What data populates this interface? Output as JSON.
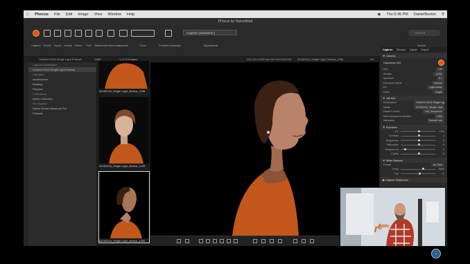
{
  "menubar": {
    "app": "Phocus",
    "items": [
      "File",
      "Edit",
      "Image",
      "View",
      "Window",
      "Help"
    ],
    "clock": "Thu 5:36 PM",
    "user": "DanielNorton"
  },
  "window_title": "Phocus by Hasselblad",
  "toolbar": {
    "items": [
      "Capture",
      "Export",
      "Import",
      "Modify",
      "Delete",
      "Print",
      "Slideshow",
      "Preferences",
      "Layouts",
      "Show",
      "Portrait/Landscape",
      "Adjustments",
      "Search"
    ],
    "preset": "Capture (Standard+)",
    "search_placeholder": "Search"
  },
  "subbar": {
    "path": "Ordered 0316 Single Light Portrait...",
    "filter": "Unfilt",
    "count": "1 of 12 images",
    "exif": "ISO 100   1/250 sec   f/8.0   50.0   ISO 80",
    "filename": "04182016_Single Light_Marisa_1300",
    "zoom": "9%"
  },
  "sidebar": {
    "items": [
      {
        "label": "Capture Destination",
        "head": true
      },
      {
        "label": "Ordered 0316 Single Light Portrait",
        "sel": true
      },
      {
        "label": "Favorites",
        "head": true
      },
      {
        "label": "danielnorton"
      },
      {
        "label": "Desktop"
      },
      {
        "label": "Pictures"
      },
      {
        "label": "Collections",
        "head": true
      },
      {
        "label": "Quick Collection"
      },
      {
        "label": "File System",
        "head": true
      },
      {
        "label": "Daniel Norton Macbook Pro"
      },
      {
        "label": "Podcast"
      }
    ]
  },
  "thumbnails": [
    {
      "caption": "04182016_Single Light_Marisa_1298"
    },
    {
      "caption": "04182016_Single Light_Marisa_1299"
    },
    {
      "caption": "04182016_Single Light_Marisa_1300"
    }
  ],
  "right_panel": {
    "tabs": [
      "Capture",
      "Browse",
      "Adjust",
      "Export"
    ],
    "active_tab": "Capture",
    "camera_section": "Camera",
    "camera_model": "Hasselblad H5X",
    "camera_rows": [
      {
        "label": "ISO",
        "value": "100"
      },
      {
        "label": "Shutter",
        "value": "1/250"
      },
      {
        "label": "Aperture",
        "value": "8.0"
      },
      {
        "label": "Exposure Mode",
        "value": "Manual"
      },
      {
        "label": "EV",
        "value": "Light Meter"
      },
      {
        "label": "Drive",
        "value": "Single"
      }
    ],
    "job_section": "Job Info",
    "job_rows": [
      {
        "label": "Destination",
        "value": "Ordered 0316 Single Light P..."
      },
      {
        "label": "Name",
        "value": "04182016_Single Light_Marisa_..."
      },
      {
        "label": "Name Format",
        "value": "Job_Sequence"
      },
      {
        "label": "Next Sequence Number",
        "value": "1301"
      },
      {
        "label": "Metadata",
        "value": "Default Info"
      }
    ],
    "exposure_section": "Exposure",
    "exposure_sliders": [
      {
        "label": "EV",
        "value": "0.00",
        "pos": 0.5
      },
      {
        "label": "Contrast",
        "value": "0",
        "pos": 0.5
      },
      {
        "label": "Brightness",
        "value": "0",
        "pos": 0.5
      },
      {
        "label": "Saturation",
        "value": "0",
        "pos": 0.5
      },
      {
        "label": "Shadow Fill",
        "value": "0",
        "pos": 0.1
      },
      {
        "label": "Clarity",
        "value": "0",
        "pos": 0.5
      }
    ],
    "wb_section": "White Balance",
    "wb_preset": "As Shot",
    "wb_sliders": [
      {
        "label": "Temp",
        "value": "5650",
        "pos": 0.62
      },
      {
        "label": "Tint",
        "value": "+2",
        "pos": 0.52
      }
    ],
    "capture_seq": "Capture Sequencer"
  },
  "colors": {
    "accent": "#e05a1a",
    "sweater": "#c2571b"
  }
}
